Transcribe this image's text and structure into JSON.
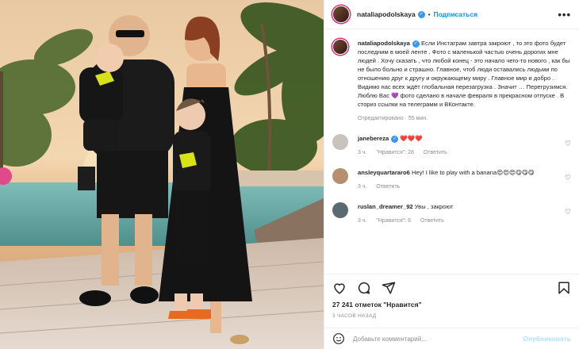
{
  "post": {
    "author": "nataliapodolskaya",
    "follow_label": "Подписаться",
    "separator": "•",
    "more_label": "•••"
  },
  "caption": {
    "username": "nataliapodolskaya",
    "text": "Если Инстаграм завтра закроют , то это фото будет последним в моей ленте . Фото с маленькой частью очень дорогих мне людей . Хочу сказать , что любой конец - это начало чего-то нового , как бы не было больно и страшно. Главное, чтоб люди оставались людьми по отношению друг к другу и окружающему миру . Главное мир и добро . Видимо нас всех ждёт глобальная перезагрузка . Значит … Перегрузимся. Люблю Вас 💜 фото сделано в начале февраля в прекрасном отпуске . В сториз ссылки на телеграмм и ВКонтакте.",
    "meta": "Отредактировано · 55 мин."
  },
  "comments": [
    {
      "username": "janebereza",
      "text": "❤️❤️❤️",
      "time": "3 ч.",
      "likes": "\"Нравится\": 28",
      "reply": "Ответить",
      "avatar_color": "#c9c3bd"
    },
    {
      "username": "ansleyquartararo6",
      "text": "Hey! I like to play with a banana😍😍😍😋😋😋",
      "time": "3 ч.",
      "likes": "",
      "reply": "Ответить",
      "avatar_color": "#b58f6e"
    },
    {
      "username": "ruslan_dreamer_92",
      "text": "Увы , закроют",
      "time": "3 ч.",
      "likes": "\"Нравится\": 6",
      "reply": "Ответить",
      "avatar_color": "#5b6a72"
    }
  ],
  "stats": {
    "likes": "27 241 отметок \"Нравится\"",
    "time": "3 ЧАСОВ НАЗАД"
  },
  "add_comment": {
    "placeholder": "Добавьте комментарий...",
    "publish_label": "Опубликовать"
  },
  "colors": {
    "accent": "#0095f6",
    "publish_disabled": "#b2dffc",
    "muted": "#8e8e8e",
    "border": "#efefef"
  },
  "icons": [
    "heart-icon",
    "comment-icon",
    "share-icon",
    "bookmark-icon",
    "emoji-icon",
    "more-icon",
    "verified-icon"
  ]
}
